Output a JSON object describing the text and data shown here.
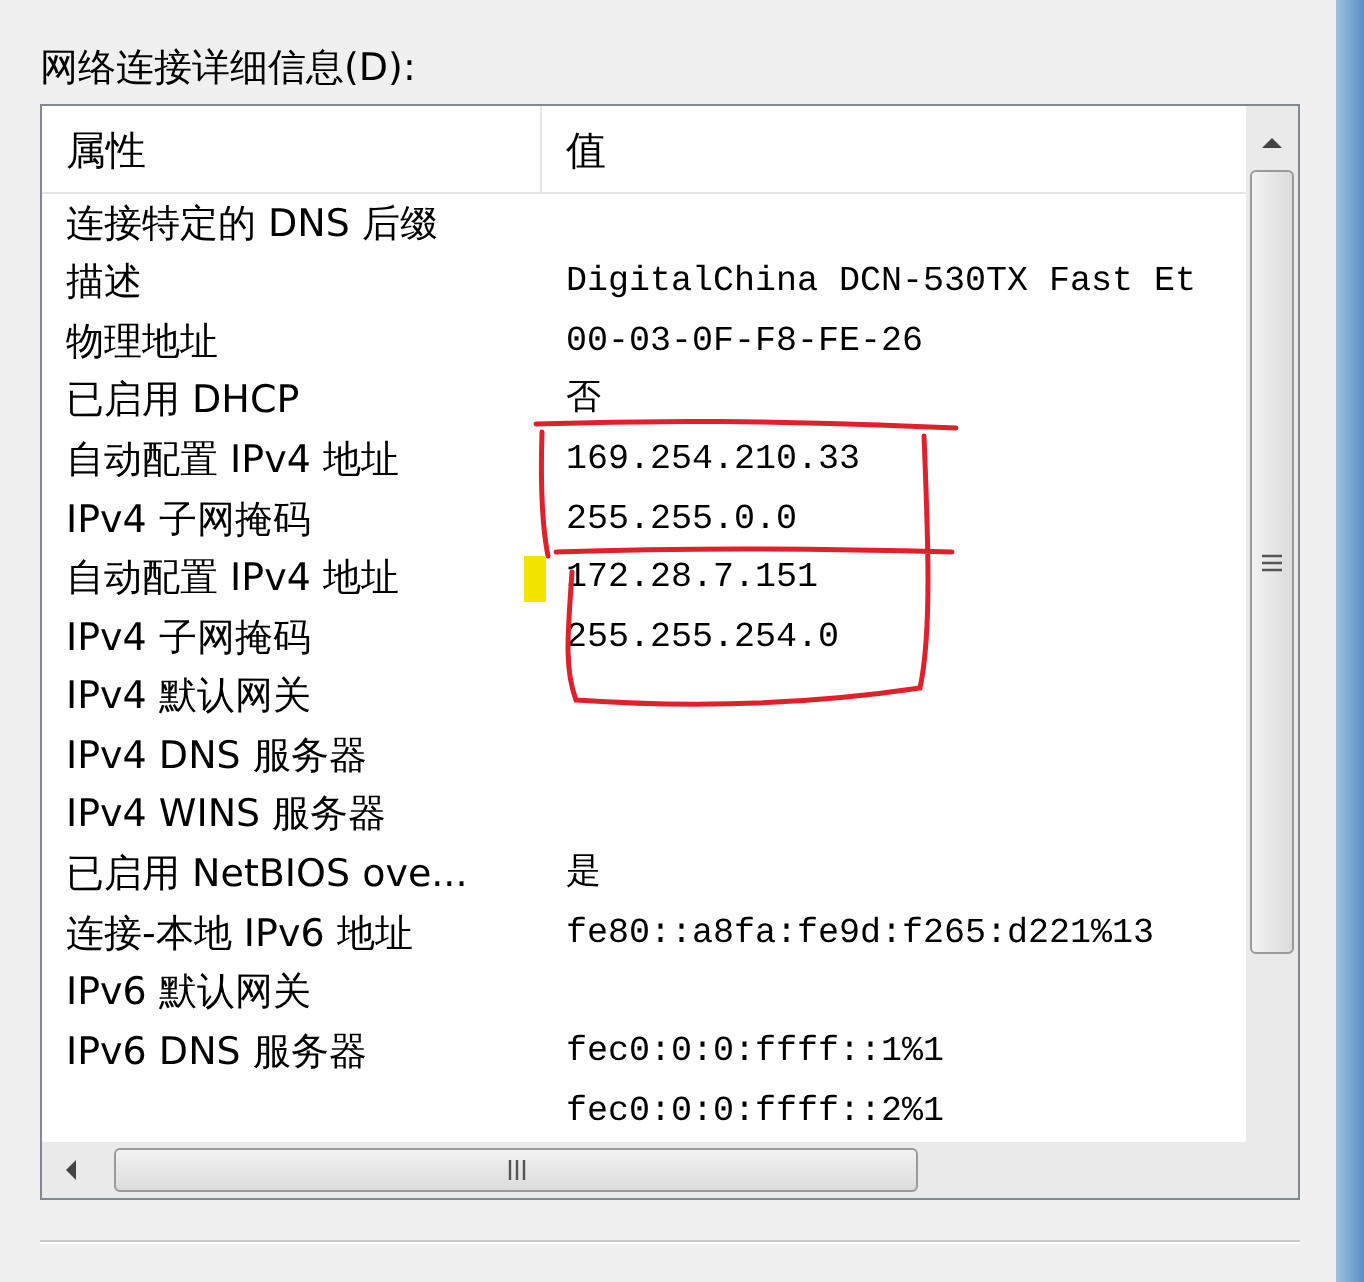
{
  "label": "网络连接详细信息(D):",
  "table": {
    "columns": [
      "属性",
      "值"
    ],
    "rows": [
      {
        "property": "连接特定的 DNS 后缀",
        "value": ""
      },
      {
        "property": "描述",
        "value": "DigitalChina DCN-530TX Fast Et"
      },
      {
        "property": "物理地址",
        "value": "00-03-0F-F8-FE-26"
      },
      {
        "property": "已启用 DHCP",
        "value": "否"
      },
      {
        "property": "自动配置 IPv4 地址",
        "value": "169.254.210.33"
      },
      {
        "property": "IPv4 子网掩码",
        "value": "255.255.0.0"
      },
      {
        "property": "自动配置 IPv4 地址",
        "value": "172.28.7.151"
      },
      {
        "property": "IPv4 子网掩码",
        "value": "255.255.254.0"
      },
      {
        "property": "IPv4 默认网关",
        "value": ""
      },
      {
        "property": "IPv4 DNS 服务器",
        "value": ""
      },
      {
        "property": "IPv4 WINS 服务器",
        "value": ""
      },
      {
        "property": "已启用 NetBIOS ove...",
        "value": "是"
      },
      {
        "property": "连接-本地 IPv6 地址",
        "value": "fe80::a8fa:fe9d:f265:d221%13"
      },
      {
        "property": "IPv6 默认网关",
        "value": ""
      },
      {
        "property": "IPv6 DNS 服务器",
        "value": "fec0:0:0:ffff::1%1"
      },
      {
        "property": "",
        "value": "fec0:0:0:ffff::2%1"
      }
    ]
  }
}
